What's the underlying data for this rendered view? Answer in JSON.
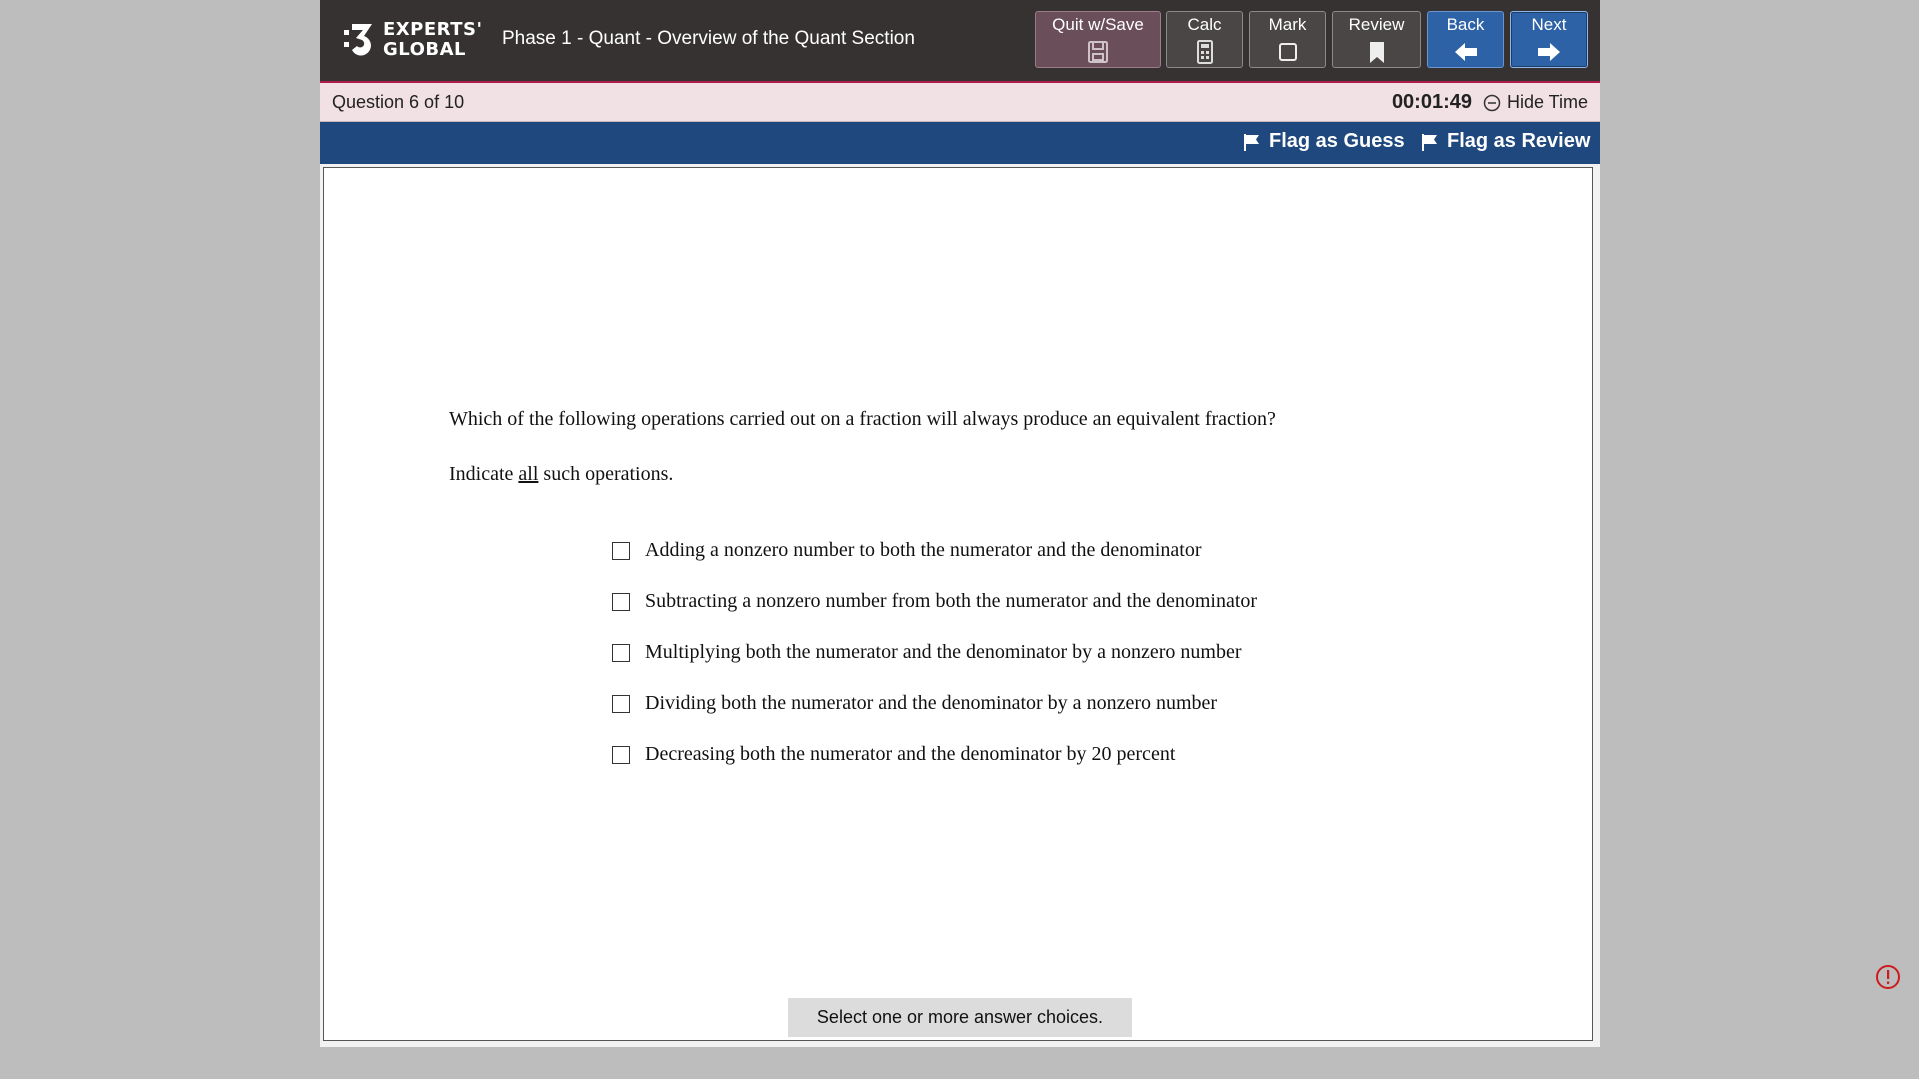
{
  "header": {
    "logo_line1": "EXPERTS'",
    "logo_line2": "GLOBAL",
    "exam_title": "Phase 1 - Quant - Overview of the Quant Section",
    "buttons": {
      "quit": "Quit w/Save",
      "calc": "Calc",
      "mark": "Mark",
      "review": "Review",
      "back": "Back",
      "next": "Next"
    }
  },
  "status": {
    "question_counter": "Question 6 of 10",
    "timer": "00:01:49",
    "hide_time": "Hide Time"
  },
  "flags": {
    "guess": "Flag as Guess",
    "review": "Flag as Review"
  },
  "question": {
    "text": "Which of the following operations carried out on a fraction will always produce an equivalent fraction?",
    "instruction_before": "Indicate ",
    "instruction_emph": "all",
    "instruction_after": " such operations.",
    "choices": [
      "Adding a nonzero number to both the numerator and the denominator",
      "Subtracting a nonzero number from both the numerator and the denominator",
      "Multiplying both the numerator and the denominator by a nonzero number",
      "Dividing both the numerator and the denominator by a nonzero number",
      "Decreasing both the numerator and the denominator by 20 percent"
    ]
  },
  "hint": "Select one or more answer choices.",
  "colors": {
    "header_bg": "#363232",
    "accent_line": "#b01a4a",
    "status_bg": "#f1e0e4",
    "flagbar_bg": "#1f487e",
    "nav_button": "#2d62a6",
    "error": "#d0191c"
  },
  "icons": {
    "quit": "save-icon",
    "calc": "calculator-icon",
    "mark": "checkbox-icon",
    "review": "bookmark-icon",
    "back": "arrow-left-icon",
    "next": "arrow-right-icon",
    "hide_time": "minus-circle-icon",
    "flag": "flag-icon",
    "error": "exclamation-circle-icon"
  }
}
